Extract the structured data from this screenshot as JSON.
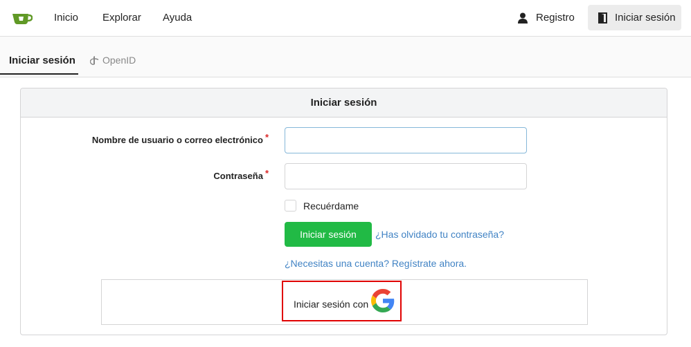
{
  "nav": {
    "logo": "gitea-logo-icon",
    "links": [
      "Inicio",
      "Explorar",
      "Ayuda"
    ],
    "register_label": "Registro",
    "signin_label": "Iniciar sesión"
  },
  "tabs": {
    "active": "Iniciar sesión",
    "openid": "OpenID"
  },
  "form": {
    "title": "Iniciar sesión",
    "username_label": "Nombre de usuario o correo electrónico",
    "password_label": "Contraseña",
    "required_mark": "*",
    "username_value": "",
    "password_value": "",
    "remember_label": "Recuérdame",
    "submit_label": "Iniciar sesión",
    "forgot_label": "¿Has olvidado tu contraseña?",
    "register_label": "¿Necesitas una cuenta? Regístrate ahora.",
    "oauth_label": "Iniciar sesión con",
    "oauth_provider_icon": "google-icon"
  },
  "colors": {
    "primary_button": "#21ba45",
    "link": "#4183c4",
    "required": "#db2828",
    "highlight": "#e00000"
  }
}
